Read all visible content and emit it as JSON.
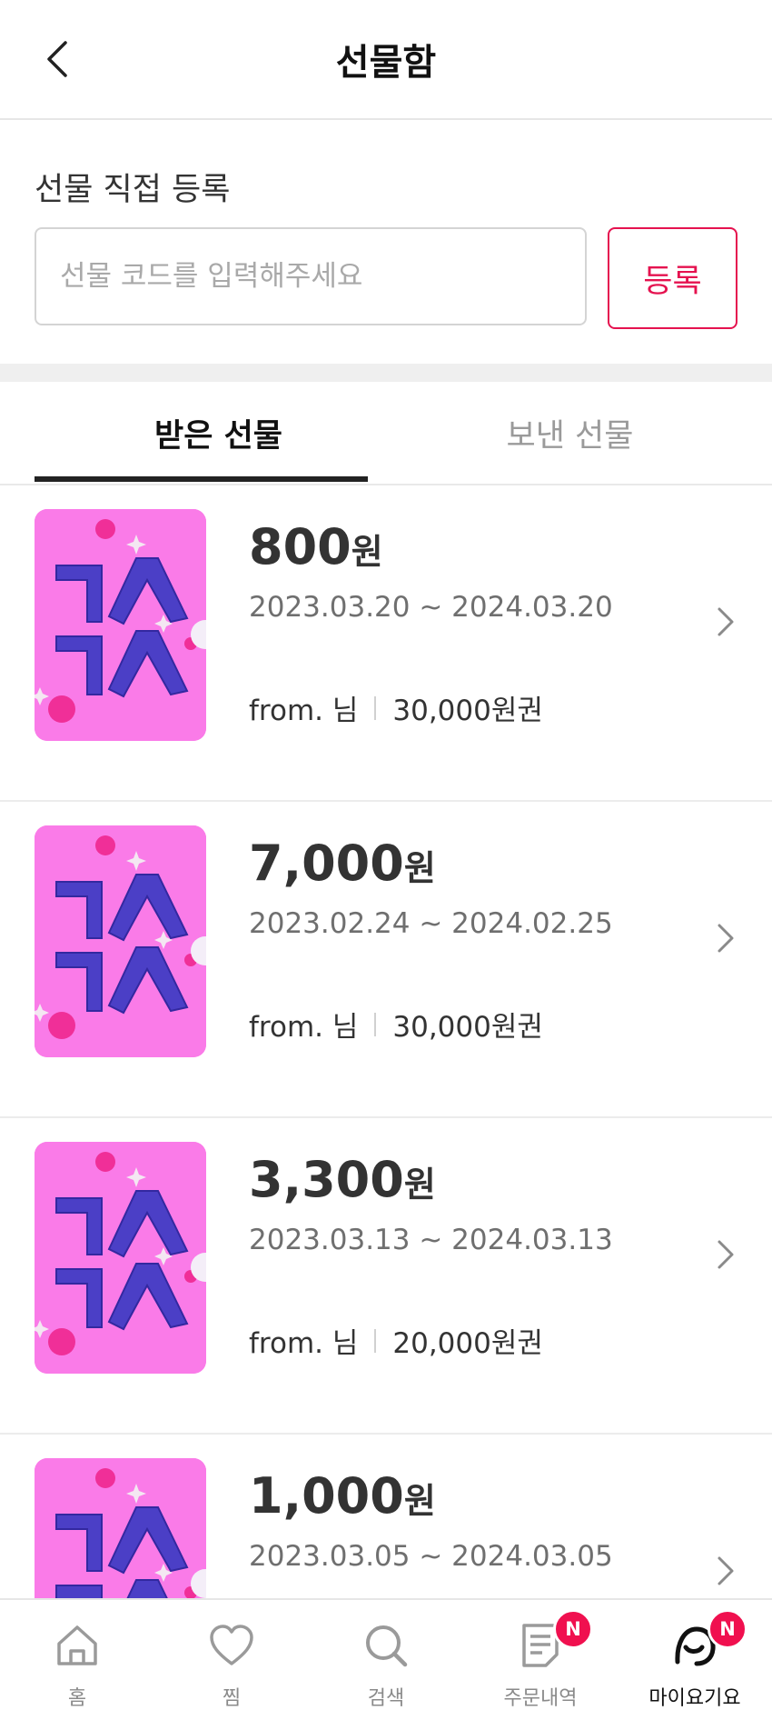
{
  "header": {
    "title": "선물함"
  },
  "register": {
    "title": "선물 직접 등록",
    "input_placeholder": "선물 코드를 입력해주세요",
    "input_value": "",
    "button_label": "등록"
  },
  "tabs": [
    {
      "label": "받은 선물",
      "active": true
    },
    {
      "label": "보낸 선물",
      "active": false
    }
  ],
  "gifts": [
    {
      "amount": "800",
      "unit": "원",
      "period": "2023.03.20 ~ 2024.03.20",
      "from": "from. 님",
      "voucher": "30,000원권"
    },
    {
      "amount": "7,000",
      "unit": "원",
      "period": "2023.02.24 ~ 2024.02.25",
      "from": "from. 님",
      "voucher": "30,000원권"
    },
    {
      "amount": "3,300",
      "unit": "원",
      "period": "2023.03.13 ~ 2024.03.13",
      "from": "from. 님",
      "voucher": "20,000원권"
    },
    {
      "amount": "1,000",
      "unit": "원",
      "period": "2023.03.05 ~ 2024.03.05",
      "from": "",
      "voucher": ""
    }
  ],
  "bottom_nav": [
    {
      "label": "홈",
      "icon": "home-icon",
      "badge": ""
    },
    {
      "label": "찜",
      "icon": "heart-icon",
      "badge": ""
    },
    {
      "label": "검색",
      "icon": "search-icon",
      "badge": ""
    },
    {
      "label": "주문내역",
      "icon": "order-history-icon",
      "badge": "N"
    },
    {
      "label": "마이요기요",
      "icon": "my-yogiyo-icon",
      "badge": "N"
    }
  ],
  "colors": {
    "accent": "#e5124f",
    "badge": "#f0104f",
    "card_pink": "#fa7be8",
    "card_letters": "#4b3fc6"
  }
}
